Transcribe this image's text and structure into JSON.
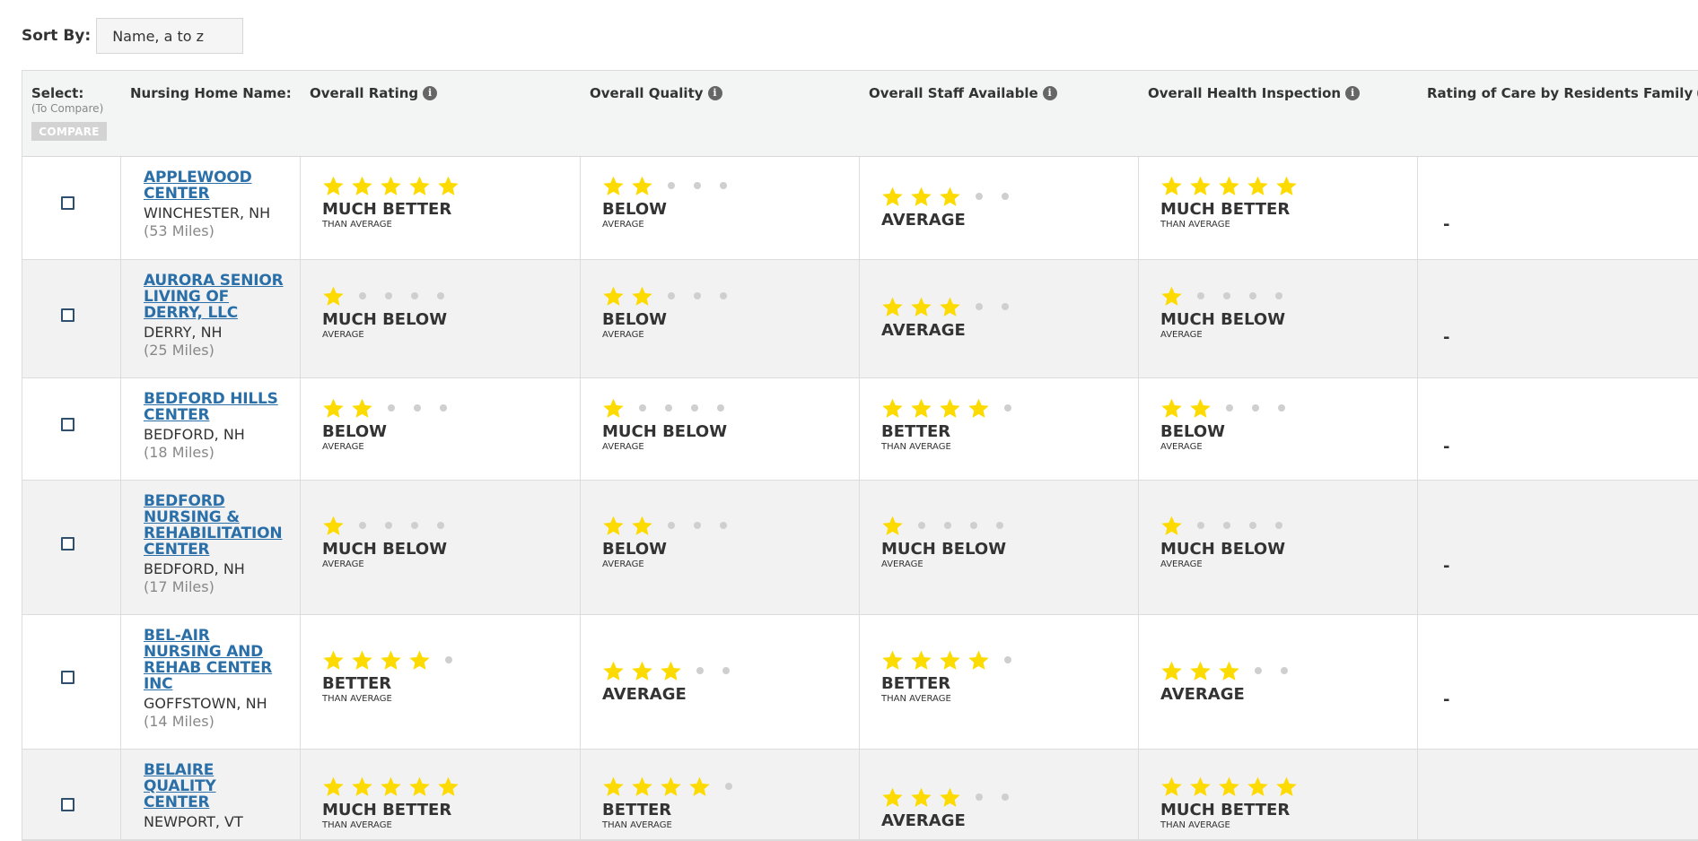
{
  "sort": {
    "label": "Sort By:",
    "value": "Name, a to z"
  },
  "header": {
    "select": "Select:",
    "select_sub": "(To Compare)",
    "compare": "COMPARE",
    "name": "Nursing Home Name:",
    "overall_rating": "Overall Rating",
    "overall_quality": "Overall Quality",
    "overall_staff": "Overall Staff Available",
    "overall_health": "Overall Health Inspection",
    "family_rating": "Rating of Care by Residents Family",
    "info_icon": "i"
  },
  "colors": {
    "star": "#fddb00",
    "link": "#2a6fa8",
    "header_bg": "#f3f4f4"
  },
  "rows": [
    {
      "name_lines": [
        "APPLEWOOD",
        "CENTER"
      ],
      "location": "WINCHESTER, NH",
      "distance": "(53 Miles)",
      "ratings": [
        {
          "stars": 5,
          "main": "MUCH BETTER",
          "sub": "THAN AVERAGE"
        },
        {
          "stars": 2,
          "main": "BELOW",
          "sub": "AVERAGE"
        },
        {
          "stars": 3,
          "main": "AVERAGE",
          "sub": ""
        },
        {
          "stars": 5,
          "main": "MUCH BETTER",
          "sub": "THAN AVERAGE"
        }
      ],
      "family": "-"
    },
    {
      "name_lines": [
        "AURORA SENIOR",
        "LIVING OF",
        "DERRY, LLC"
      ],
      "location": "DERRY, NH",
      "distance": "(25 Miles)",
      "ratings": [
        {
          "stars": 1,
          "main": "MUCH BELOW",
          "sub": "AVERAGE"
        },
        {
          "stars": 2,
          "main": "BELOW",
          "sub": "AVERAGE"
        },
        {
          "stars": 3,
          "main": "AVERAGE",
          "sub": ""
        },
        {
          "stars": 1,
          "main": "MUCH BELOW",
          "sub": "AVERAGE"
        }
      ],
      "family": "-"
    },
    {
      "name_lines": [
        "BEDFORD HILLS",
        "CENTER"
      ],
      "location": "BEDFORD, NH",
      "distance": "(18 Miles)",
      "ratings": [
        {
          "stars": 2,
          "main": "BELOW",
          "sub": "AVERAGE"
        },
        {
          "stars": 1,
          "main": "MUCH BELOW",
          "sub": "AVERAGE"
        },
        {
          "stars": 4,
          "main": "BETTER",
          "sub": "THAN AVERAGE"
        },
        {
          "stars": 2,
          "main": "BELOW",
          "sub": "AVERAGE"
        }
      ],
      "family": "-"
    },
    {
      "name_lines": [
        "BEDFORD",
        "NURSING &",
        "REHABILITATION",
        "CENTER"
      ],
      "location": "BEDFORD, NH",
      "distance": "(17 Miles)",
      "ratings": [
        {
          "stars": 1,
          "main": "MUCH BELOW",
          "sub": "AVERAGE"
        },
        {
          "stars": 2,
          "main": "BELOW",
          "sub": "AVERAGE"
        },
        {
          "stars": 1,
          "main": "MUCH BELOW",
          "sub": "AVERAGE"
        },
        {
          "stars": 1,
          "main": "MUCH BELOW",
          "sub": "AVERAGE"
        }
      ],
      "family": "-"
    },
    {
      "name_lines": [
        "BEL-AIR",
        "NURSING AND",
        "REHAB CENTER",
        "INC"
      ],
      "location": "GOFFSTOWN, NH",
      "distance": "(14 Miles)",
      "ratings": [
        {
          "stars": 4,
          "main": "BETTER",
          "sub": "THAN AVERAGE"
        },
        {
          "stars": 3,
          "main": "AVERAGE",
          "sub": ""
        },
        {
          "stars": 4,
          "main": "BETTER",
          "sub": "THAN AVERAGE"
        },
        {
          "stars": 3,
          "main": "AVERAGE",
          "sub": ""
        }
      ],
      "family": "-"
    },
    {
      "name_lines": [
        "BELAIRE",
        "QUALITY",
        "CENTER"
      ],
      "location": "NEWPORT, VT",
      "distance": "",
      "ratings": [
        {
          "stars": 5,
          "main": "MUCH BETTER",
          "sub": "THAN AVERAGE"
        },
        {
          "stars": 4,
          "main": "BETTER",
          "sub": "THAN AVERAGE"
        },
        {
          "stars": 3,
          "main": "AVERAGE",
          "sub": ""
        },
        {
          "stars": 5,
          "main": "MUCH BETTER",
          "sub": "THAN AVERAGE"
        }
      ],
      "family": ""
    }
  ]
}
